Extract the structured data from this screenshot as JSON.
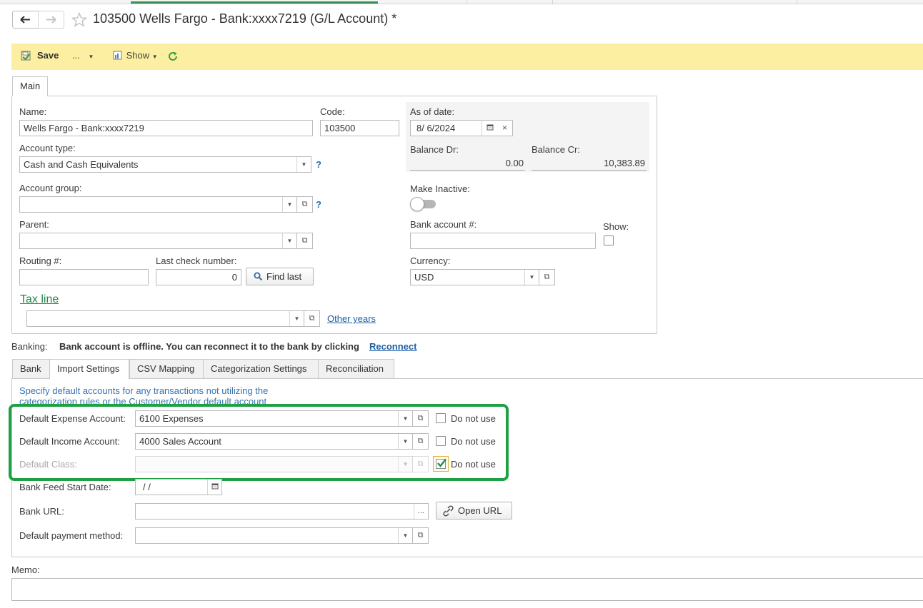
{
  "window": {
    "title": "103500 Wells Fargo - Bank:xxxx7219 (G/L Account) *"
  },
  "toolbar": {
    "save_label": "Save",
    "more_label": "...",
    "show_label": "Show"
  },
  "main_tab": {
    "label": "Main"
  },
  "main": {
    "name_label": "Name:",
    "name_value": "Wells Fargo - Bank:xxxx7219",
    "code_label": "Code:",
    "code_value": "103500",
    "account_type_label": "Account type:",
    "account_type_value": "Cash and Cash Equivalents",
    "account_group_label": "Account group:",
    "account_group_value": "",
    "parent_label": "Parent:",
    "parent_value": "",
    "routing_label": "Routing #:",
    "routing_value": "",
    "last_check_label": "Last check number:",
    "last_check_value": "0",
    "find_last_label": "Find last",
    "tax_line_label": "Tax line",
    "tax_line_value": "",
    "other_years_label": "Other years",
    "help_mark": "?"
  },
  "balance": {
    "as_of_label": "As of date:",
    "as_of_value": "8/ 6/2024",
    "dr_label": "Balance Dr:",
    "dr_value": "0.00",
    "cr_label": "Balance Cr:",
    "cr_value": "10,383.89"
  },
  "right": {
    "make_inactive_label": "Make Inactive:",
    "bank_account_label": "Bank account #:",
    "bank_account_value": "",
    "show_label": "Show:",
    "currency_label": "Currency:",
    "currency_value": "USD"
  },
  "banking": {
    "label": "Banking:",
    "message": "Bank account is offline. You can reconnect it to the bank by clicking",
    "reconnect_label": "Reconnect"
  },
  "banking_tabs": [
    {
      "label": "Bank"
    },
    {
      "label": "Import Settings"
    },
    {
      "label": "CSV Mapping"
    },
    {
      "label": "Categorization Settings"
    },
    {
      "label": "Reconciliation"
    }
  ],
  "import_settings": {
    "hint_line1": "Specify default accounts for any transactions not utilizing the",
    "hint_line2": "categorization rules or the Customer/Vendor default account",
    "expense_label": "Default Expense Account:",
    "expense_value": "6100 Expenses",
    "income_label": "Default Income Account:",
    "income_value": "4000 Sales Account",
    "class_label": "Default Class:",
    "class_value": "",
    "do_not_use_label": "Do not use",
    "feed_start_label": "Bank Feed Start Date:",
    "feed_start_value": "/  /",
    "bank_url_label": "Bank URL:",
    "bank_url_value": "",
    "bank_url_more": "...",
    "open_url_label": "Open URL",
    "payment_method_label": "Default payment method:",
    "payment_method_value": ""
  },
  "memo": {
    "label": "Memo:",
    "value": ""
  },
  "colors": {
    "toolbar_bg": "#fcefa1",
    "highlight_border": "#1fa045",
    "link": "#1f5fa3",
    "tax_line_link": "#23874a",
    "refresh_icon": "#3aa043",
    "checked_mark": "#1f8a52"
  }
}
